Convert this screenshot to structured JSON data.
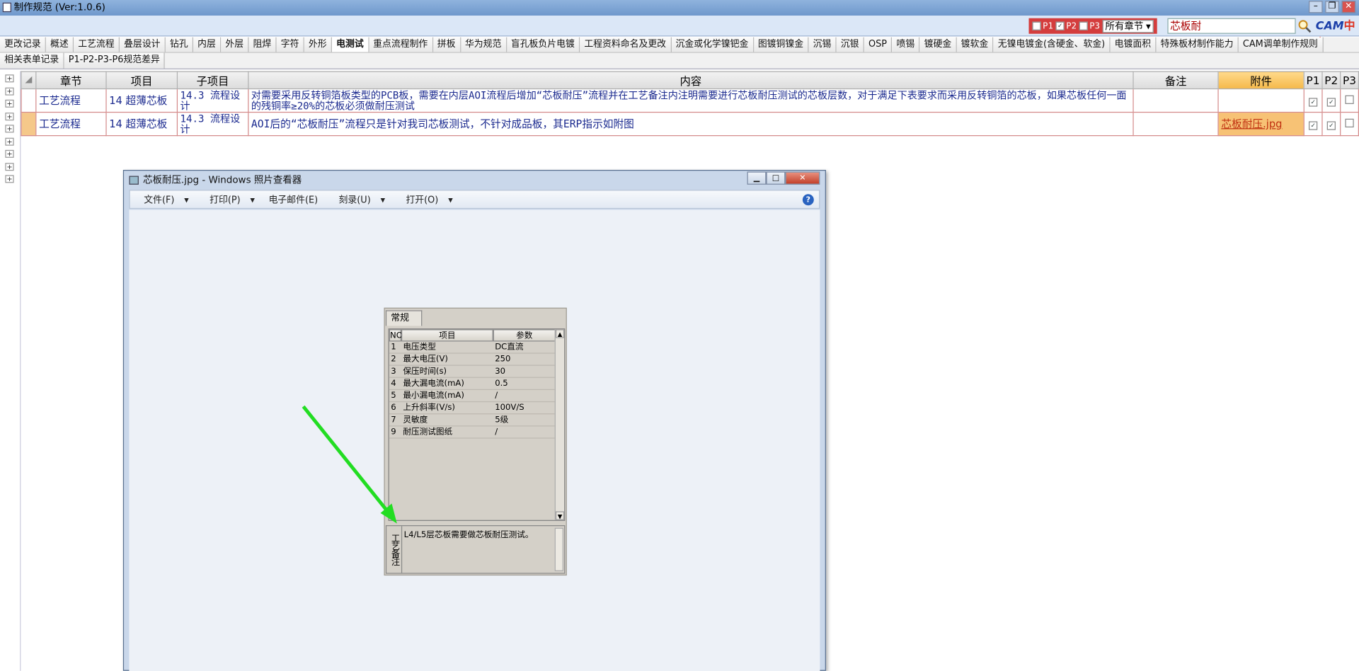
{
  "window": {
    "title": "制作规范 (Ver:1.0.6)"
  },
  "filters": {
    "p1": "P1",
    "p2": "P2",
    "p3": "P3",
    "p1_checked": false,
    "p2_checked": true,
    "p3_checked": false,
    "chapter_select": "所有章节",
    "search_value": "芯板耐"
  },
  "logo": {
    "left": "CAM",
    "right": "中心"
  },
  "tabs_row1": [
    "更改记录",
    "概述",
    "工艺流程",
    "叠层设计",
    "钻孔",
    "内层",
    "外层",
    "阻焊",
    "字符",
    "外形",
    "电测试",
    "重点流程制作",
    "拼板",
    "华为规范",
    "盲孔板负片电镀",
    "工程资料命名及更改",
    "沉金或化学镍钯金",
    "图镀铜镍金",
    "沉锡",
    "沉银",
    "OSP",
    "喷锡",
    "镀硬金",
    "镀软金",
    "无镍电镀金(含硬金、软金)",
    "电镀面积",
    "特殊板材制作能力",
    "CAM调单制作规则"
  ],
  "tabs_row2": [
    "相关表单记录",
    "P1-P2-P3-P6规范差异"
  ],
  "active_tab": "电测试",
  "table": {
    "headers": {
      "chapter": "章节",
      "item": "项目",
      "subitem": "子项目",
      "content": "内容",
      "remark": "备注",
      "attach": "附件",
      "p1": "P1",
      "p2": "P2",
      "p3": "P3"
    },
    "rows": [
      {
        "chapter": "工艺流程",
        "item": "14 超薄芯板",
        "subitem": "14.3 流程设计",
        "content": "对需要采用反转铜箔板类型的PCB板，需要在内层AOI流程后增加“芯板耐压”流程并在工艺备注内注明需要进行芯板耐压测试的芯板层数，对于满足下表要求而采用反转铜箔的芯板，如果芯板任何一面的残铜率≥20%的芯板必须做耐压测试",
        "remark": "",
        "attach": "",
        "p1": "✓",
        "p2": "✓",
        "p3": ""
      },
      {
        "chapter": "工艺流程",
        "item": "14 超薄芯板",
        "subitem": "14.3 流程设计",
        "content": "AOI后的“芯板耐压”流程只是针对我司芯板测试，不针对成品板，其ERP指示如附图",
        "remark": "",
        "attach": "芯板耐压.jpg",
        "p1": "✓",
        "p2": "✓",
        "p3": ""
      }
    ]
  },
  "viewer": {
    "title": "芯板耐压.jpg - Windows 照片查看器",
    "menu": {
      "file": "文件(F)",
      "print": "打印(P)",
      "email": "电子邮件(E)",
      "burn": "刻录(U)",
      "open": "打开(O)"
    },
    "help": "?",
    "image": {
      "tab": "常规",
      "head": {
        "no": "NO",
        "item": "项目",
        "param": "参数"
      },
      "rows": [
        {
          "no": "1",
          "item": "电压类型",
          "param": "DC直流"
        },
        {
          "no": "2",
          "item": "最大电压(V)",
          "param": "250"
        },
        {
          "no": "3",
          "item": "保压时间(s)",
          "param": "30"
        },
        {
          "no": "4",
          "item": "最大漏电流(mA)",
          "param": "0.5"
        },
        {
          "no": "5",
          "item": "最小漏电流(mA)",
          "param": "/"
        },
        {
          "no": "6",
          "item": "上升斜率(V/s)",
          "param": "100V/S"
        },
        {
          "no": "7",
          "item": "灵敏度",
          "param": "5级"
        },
        {
          "no": "9",
          "item": "耐压测试图纸",
          "param": "/"
        }
      ],
      "remark_label": "工艺备注",
      "remark_text": "L4/L5层芯板需要做芯板耐压测试。",
      "arrow_color": "#22dd22"
    }
  }
}
